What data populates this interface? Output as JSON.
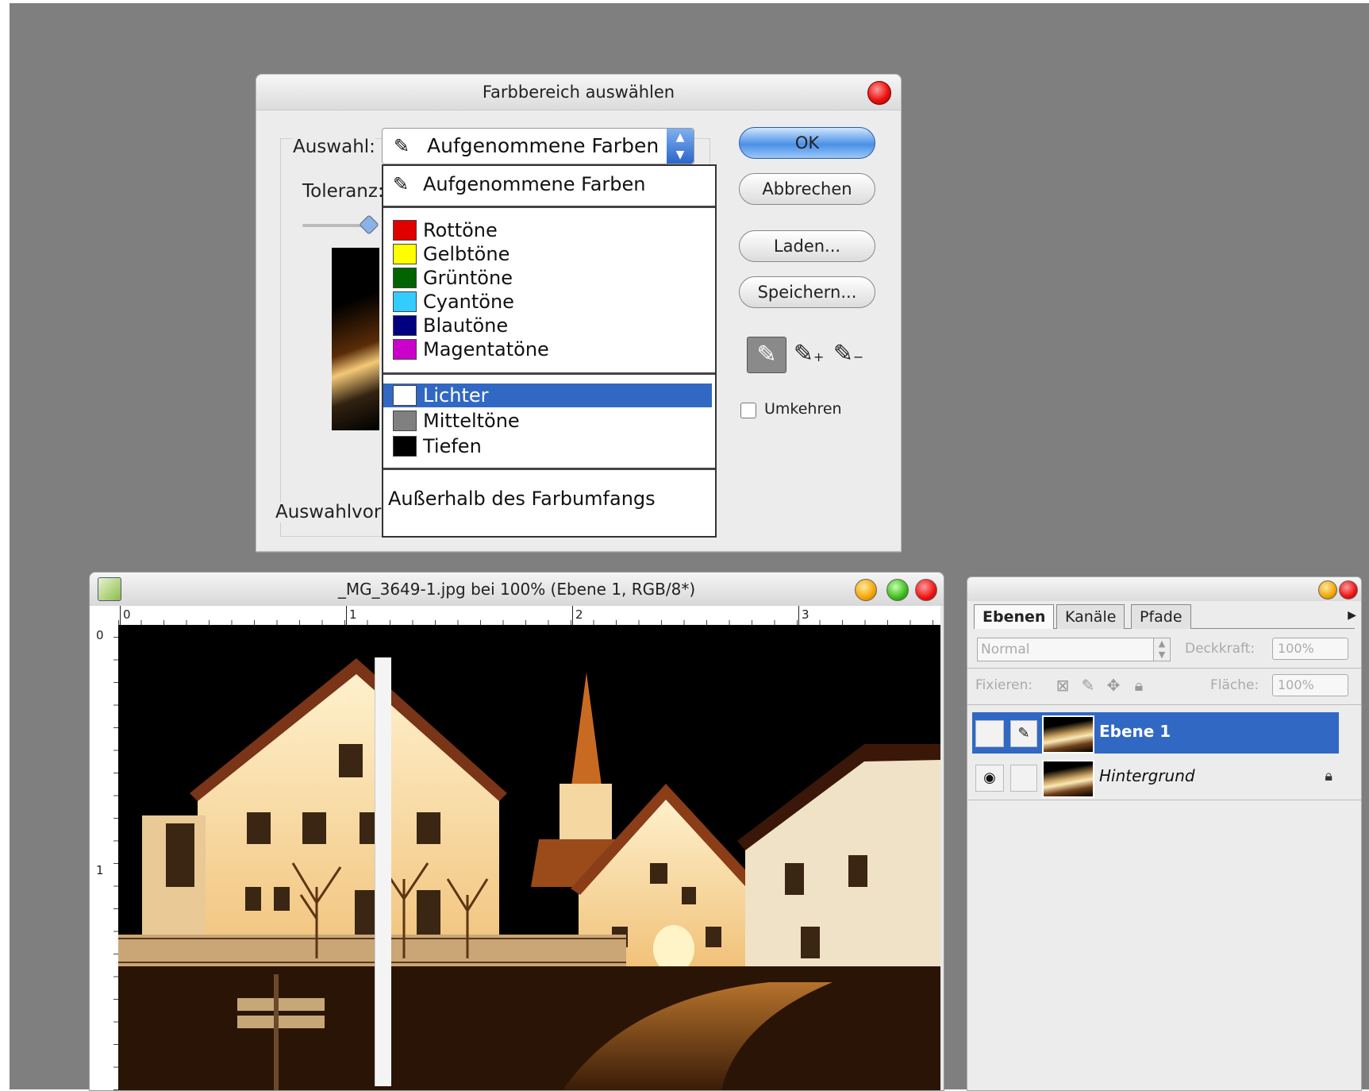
{
  "dialog": {
    "title": "Farbbereich auswählen",
    "select_label": "Auswahl:",
    "selected_value": "Aufgenommene Farben",
    "tolerance_label": "Toleranz:",
    "preview_label": "Auswahlvorschau:",
    "dropdown": {
      "sampled": "Aufgenommene Farben",
      "colors": [
        {
          "label": "Rottöne",
          "color": "#e00000"
        },
        {
          "label": "Gelbtöne",
          "color": "#ffff00"
        },
        {
          "label": "Grüntöne",
          "color": "#006400"
        },
        {
          "label": "Cyantöne",
          "color": "#33ccff"
        },
        {
          "label": "Blautöne",
          "color": "#000080"
        },
        {
          "label": "Magentatöne",
          "color": "#cc00cc"
        }
      ],
      "tones": [
        {
          "label": "Lichter",
          "color": "#ffffff"
        },
        {
          "label": "Mitteltöne",
          "color": "#808080"
        },
        {
          "label": "Tiefen",
          "color": "#000000"
        }
      ],
      "gamut": "Außerhalb des Farbumfangs",
      "selected": "Lichter"
    },
    "buttons": {
      "ok": "OK",
      "cancel": "Abbrechen",
      "load": "Laden...",
      "save": "Speichern..."
    },
    "invert_label": "Umkehren",
    "invert_checked": false
  },
  "document": {
    "title": "_MG_3649-1.jpg bei 100% (Ebene 1, RGB/8*)",
    "ruler_h": [
      "0",
      "1",
      "2",
      "3"
    ],
    "ruler_v": [
      "0",
      "1"
    ]
  },
  "layers_panel": {
    "tabs": [
      "Ebenen",
      "Kanäle",
      "Pfade"
    ],
    "active_tab": "Ebenen",
    "blend_mode": "Normal",
    "opacity_label": "Deckkraft:",
    "opacity": "100%",
    "lock_label": "Fixieren:",
    "fill_label": "Fläche:",
    "fill": "100%",
    "layers": [
      {
        "name": "Ebene 1",
        "selected": true,
        "visible": false
      },
      {
        "name": "Hintergrund",
        "selected": false,
        "visible": true,
        "locked": true
      }
    ]
  },
  "colors": {
    "selection": "#3168c4",
    "desktop": "#7f7f7f"
  }
}
